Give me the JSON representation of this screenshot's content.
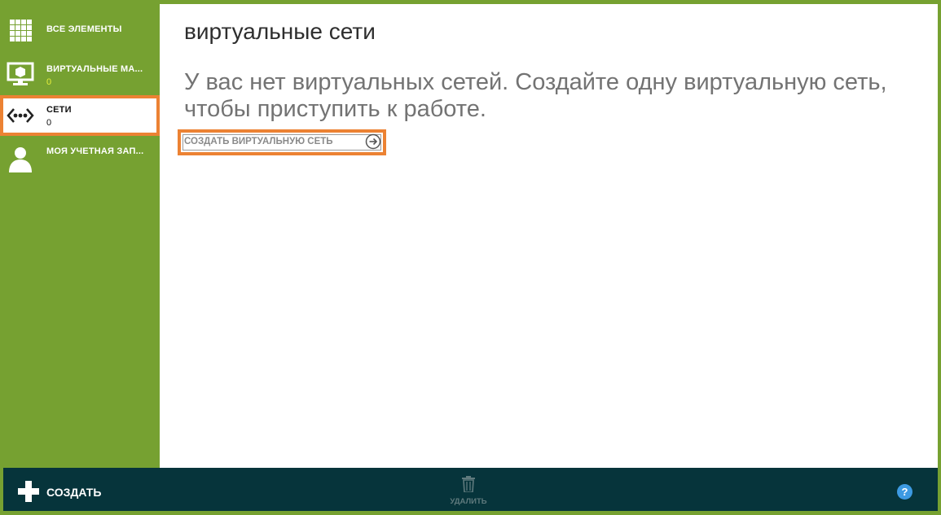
{
  "sidebar": {
    "items": [
      {
        "label": "ВСЕ ЭЛЕМЕНТЫ",
        "count": null,
        "icon": "grid-icon",
        "selected": false
      },
      {
        "label": "ВИРТУАЛЬНЫЕ МА...",
        "count": "0",
        "icon": "virtual-machine-icon",
        "selected": false
      },
      {
        "label": "СЕТИ",
        "count": "0",
        "icon": "network-icon",
        "selected": true
      },
      {
        "label": "МОЯ УЧЕТНАЯ ЗАП...",
        "count": null,
        "icon": "user-icon",
        "selected": false
      }
    ]
  },
  "main": {
    "title": "виртуальные сети",
    "empty_message": "У вас нет виртуальных сетей. Создайте одну виртуальную сеть, чтобы приступить к работе.",
    "create_link": "СОЗДАТЬ ВИРТУАЛЬНУЮ СЕТЬ"
  },
  "command_bar": {
    "new_label": "СОЗДАТЬ",
    "delete_label": "УДАЛИТЬ",
    "help_label": "?"
  },
  "colors": {
    "sidebar_bg": "#76a131",
    "highlight": "#ec8233",
    "command_bar_bg": "#06343b",
    "help_blue": "#3d9ae2"
  }
}
